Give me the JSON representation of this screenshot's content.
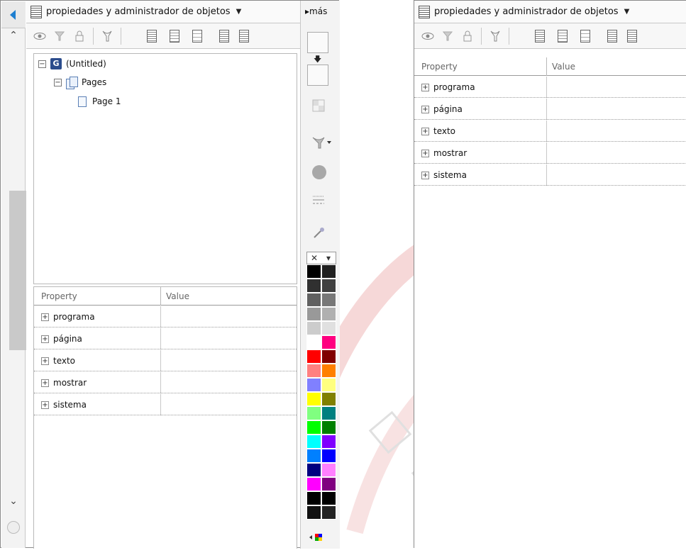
{
  "panel": {
    "title": "propiedades y administrador de objetos",
    "more_label": "más"
  },
  "tree": {
    "root": "(Untitled)",
    "pages": "Pages",
    "page1": "Page 1"
  },
  "properties": {
    "col_property": "Property",
    "col_value": "Value",
    "rows": [
      "programa",
      "página",
      "texto",
      "mostrar",
      "sistema"
    ]
  },
  "palette": {
    "colors": [
      [
        "#000000",
        "#202020"
      ],
      [
        "#303030",
        "#404040"
      ],
      [
        "#606060",
        "#787878"
      ],
      [
        "#999999",
        "#b0b0b0"
      ],
      [
        "#cccccc",
        "#e0e0e0"
      ],
      [
        "#ffffff",
        "#ff0080"
      ],
      [
        "#ff0000",
        "#800000"
      ],
      [
        "#ff8080",
        "#ff8000"
      ],
      [
        "#8080ff",
        "#ffff80"
      ],
      [
        "#ffff00",
        "#808000"
      ],
      [
        "#80ff80",
        "#008080"
      ],
      [
        "#00ff00",
        "#008000"
      ],
      [
        "#00ffff",
        "#8000ff"
      ],
      [
        "#0080ff",
        "#0000ff"
      ],
      [
        "#000080",
        "#ff80ff"
      ],
      [
        "#ff00ff",
        "#800080"
      ],
      [
        "#000000",
        "#000000"
      ],
      [
        "#111111",
        "#222222"
      ]
    ]
  },
  "icons": {
    "tb_eye": "eye-icon",
    "tb_filter": "filter-icon",
    "tb_lock": "lock-icon",
    "tb_funnel": "funnel-icon"
  }
}
